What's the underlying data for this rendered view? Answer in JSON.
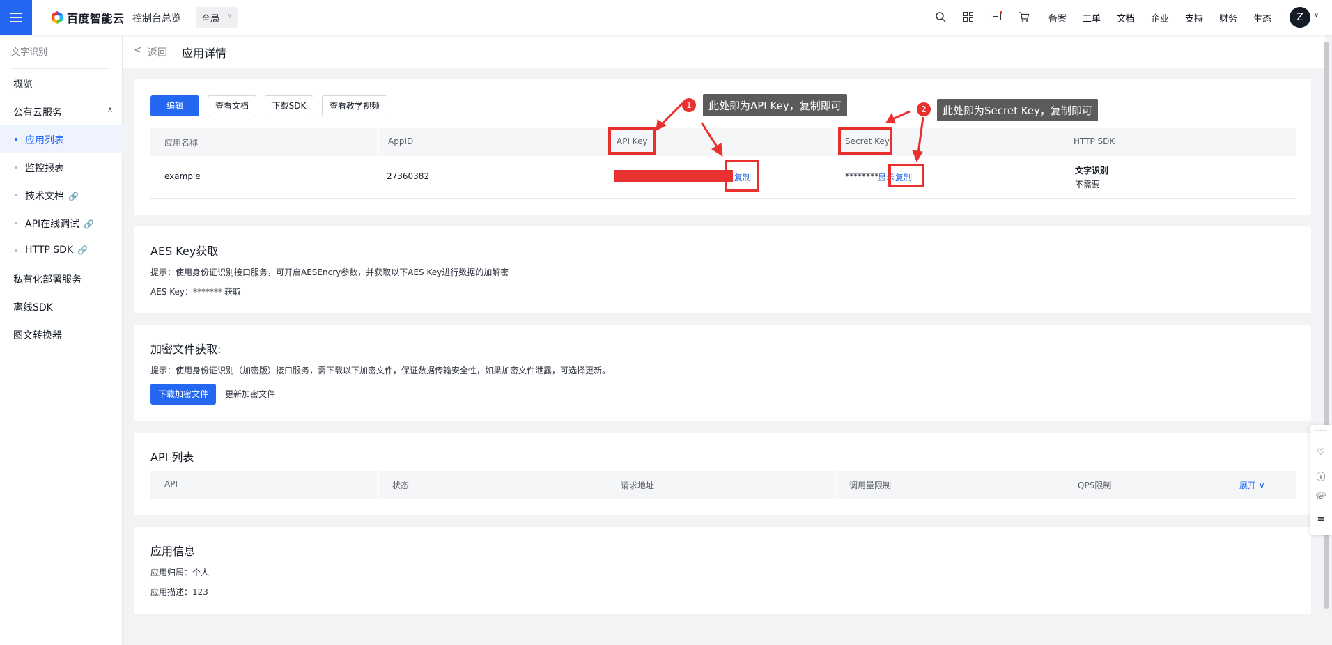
{
  "topbar": {
    "brand": "百度智能云",
    "console": "控制台总览",
    "region": "全局",
    "links": [
      "备案",
      "工单",
      "文档",
      "企业",
      "支持",
      "财务",
      "生态"
    ],
    "avatar_letter": "Z"
  },
  "sidebar": {
    "title": "文字识别",
    "items": [
      {
        "label": "概览"
      },
      {
        "label": "公有云服务"
      },
      {
        "label": "应用列表"
      },
      {
        "label": "监控报表"
      },
      {
        "label": "技术文档"
      },
      {
        "label": "API在线调试"
      },
      {
        "label": "HTTP SDK"
      },
      {
        "label": "私有化部署服务"
      },
      {
        "label": "离线SDK"
      },
      {
        "label": "图文转换器"
      }
    ]
  },
  "breadcrumb": {
    "back": "返回",
    "title": "应用详情"
  },
  "toolbar": {
    "edit": "编辑",
    "view_docs": "查看文档",
    "download_sdk": "下载SDK",
    "tutorial_video": "查看教学视频"
  },
  "app_table": {
    "headers": [
      "应用名称",
      "AppID",
      "API Key",
      "Secret Key",
      "HTTP SDK"
    ],
    "row": {
      "name": "example",
      "appid": "27360382",
      "api_copy": "复制",
      "secret_mask": "********",
      "secret_show": "显示",
      "secret_copy": "复制",
      "sdk_name": "文字识别",
      "sdk_need": "不需要"
    }
  },
  "annotations": {
    "badge1": "1",
    "tip1": "此处即为API Key，复制即可",
    "badge2": "2",
    "tip2": "此处即为Secret Key，复制即可"
  },
  "aes": {
    "title": "AES Key获取",
    "hint": "提示：使用身份证识别接口服务，可开启AESEncry参数，并获取以下AES Key进行数据的加解密",
    "key_label": "AES Key：*******",
    "get": "获取"
  },
  "encrypt": {
    "title": "加密文件获取:",
    "hint": "提示：使用身份证识别（加密版）接口服务，需下载以下加密文件，保证数据传输安全性，如果加密文件泄露，可选择更新。",
    "download": "下载加密文件",
    "update": "更新加密文件"
  },
  "api_list": {
    "title": "API 列表",
    "headers": [
      "API",
      "状态",
      "请求地址",
      "调用量限制",
      "QPS限制"
    ],
    "expand": "展开"
  },
  "app_info": {
    "title": "应用信息",
    "owner": "应用归属：个人",
    "desc": "应用描述：123"
  },
  "colors": {
    "primary": "#2468f2",
    "annotation_red": "#e8302f",
    "tooltip_bg": "#5b5b5b"
  }
}
